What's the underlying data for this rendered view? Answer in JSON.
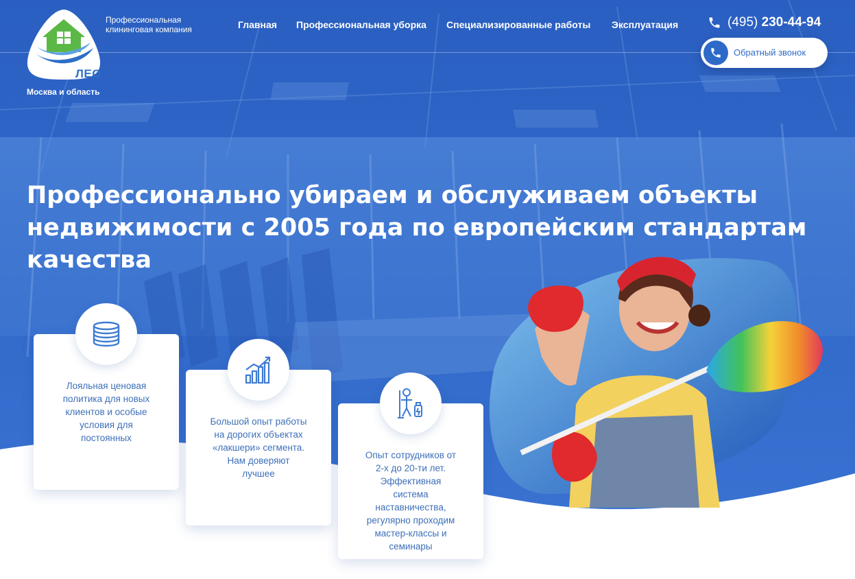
{
  "brand": {
    "logo_name": "ЛЕО",
    "tagline_line1": "Профессиональная",
    "tagline_line2": "клининговая компания",
    "region": "Москва и область"
  },
  "nav": {
    "items": [
      "Главная",
      "Профессиональная уборка",
      "Специализированные работы",
      "Эксплуатация"
    ]
  },
  "contact": {
    "phone_code": "(495)",
    "phone_number": "230-44-94",
    "callback_label": "Обратный звонок"
  },
  "hero": {
    "headline_bold": "Профессионально убираем и обслуживаем",
    "headline_rest_line1": "объекты",
    "headline_line2": "недвижимости с 2005 года по европейским стандартам качества"
  },
  "features": [
    {
      "icon": "coins-icon",
      "lines": [
        "Лояльная ценовая",
        "политика для новых",
        "клиентов и особые",
        "условия для",
        "постоянных"
      ]
    },
    {
      "icon": "growth-chart-icon",
      "lines": [
        "Большой опыт работы",
        "на дорогих объектах",
        "«лакшери» сегмента.",
        "Нам доверяют",
        "лучшее"
      ]
    },
    {
      "icon": "cleaner-icon",
      "lines": [
        "Опыт сотрудников от",
        "2-х до 20-ти лет.",
        "Эффективная",
        "система",
        "наставничества,",
        "регулярно проходим",
        "мастер-классы и",
        "семинары"
      ]
    }
  ],
  "colors": {
    "primary_blue": "#2e6ac8",
    "text_white": "#ffffff",
    "card_text": "#3d6fb8"
  }
}
